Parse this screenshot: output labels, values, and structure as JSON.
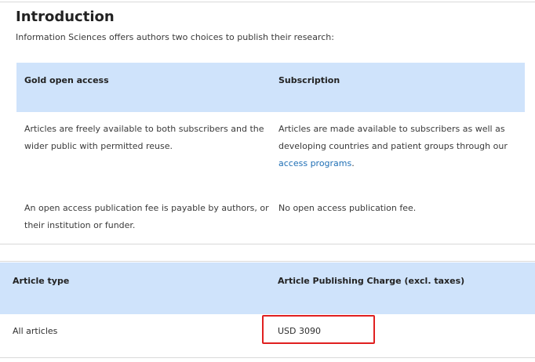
{
  "intro": {
    "title": "Introduction",
    "text": "Information Sciences offers authors two choices to publish their research:"
  },
  "choices": {
    "headers": [
      "Gold open access",
      "Subscription"
    ],
    "row1": {
      "gold": "Articles are freely available to both subscribers and the wider public with permitted reuse.",
      "subscription_prefix": "Articles are made available to subscribers as well as developing countries and patient groups through our ",
      "subscription_link": "access programs",
      "subscription_suffix": "."
    },
    "row2": {
      "gold": "An open access publication fee is payable by authors, or their institution or funder.",
      "subscription": "No open access publication fee."
    }
  },
  "apc": {
    "headers": [
      "Article type",
      "Article Publishing Charge (excl. taxes)"
    ],
    "rows": [
      {
        "type": "All articles",
        "charge": "USD 3090"
      }
    ]
  },
  "colors": {
    "header_bg": "#cfe3fb",
    "link": "#1f6fb5",
    "highlight": "#e02020"
  }
}
